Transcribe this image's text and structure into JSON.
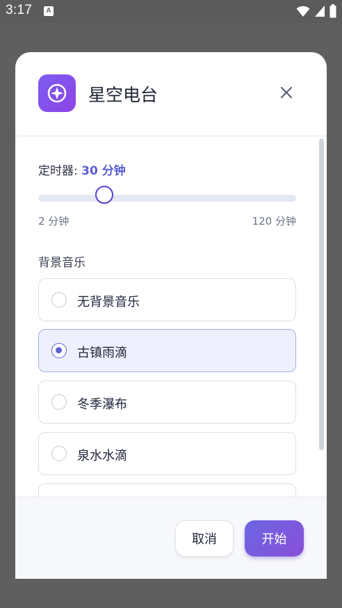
{
  "status_bar": {
    "time": "3:17",
    "notification_icon": "A",
    "icons": [
      "wifi-icon",
      "cellular-icon",
      "battery-icon"
    ]
  },
  "dialog": {
    "title": "星空电台",
    "app_icon": "compass-star-icon",
    "close_icon": "close-icon",
    "timer": {
      "label": "定时器: ",
      "value": "30 分钟",
      "min_label": "2 分钟",
      "max_label": "120 分钟",
      "minutes": 30,
      "min_minutes": 2,
      "max_minutes": 120
    },
    "music": {
      "label": "背景音乐",
      "options": [
        {
          "label": "无背景音乐",
          "selected": false
        },
        {
          "label": "古镇雨滴",
          "selected": true
        },
        {
          "label": "冬季瀑布",
          "selected": false
        },
        {
          "label": "泉水水滴",
          "selected": false
        }
      ]
    },
    "buttons": {
      "cancel": "取消",
      "start": "开始"
    }
  },
  "colors": {
    "accent": "#5b5fd4",
    "slider_thumb": "#5443d6",
    "icon_gradient_start": "#7c5cf0",
    "icon_gradient_end": "#8e44e8",
    "selected_bg": "#eef1fd"
  }
}
